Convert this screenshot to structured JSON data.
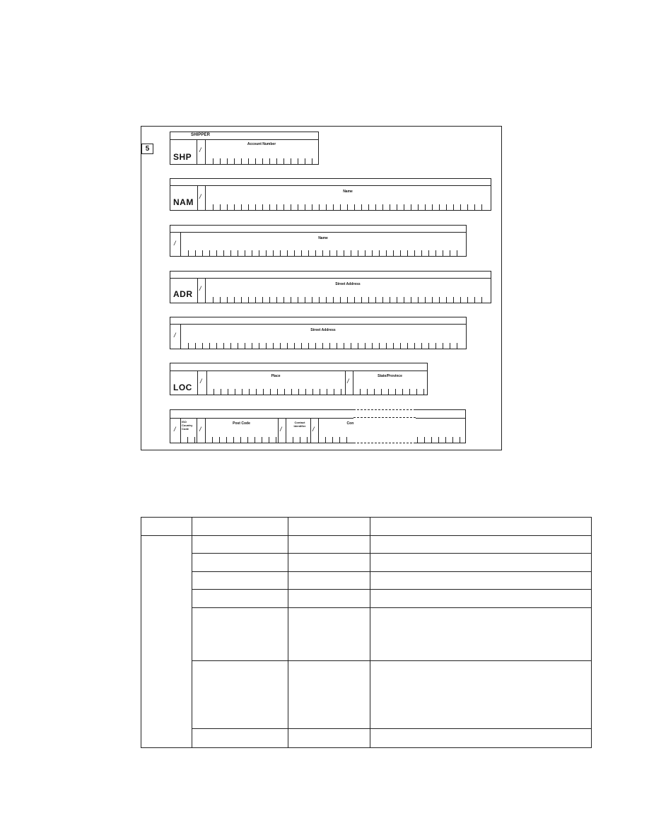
{
  "figure": {
    "step_number": "5",
    "shipper_box": {
      "title": "SHIPPER",
      "code": "SHP",
      "slash": "/",
      "field_label": "Account Number"
    },
    "name_box_1": {
      "code": "NAM",
      "slash": "/",
      "field_label": "Name"
    },
    "name_box_2": {
      "slash": "/",
      "field_label": "Name"
    },
    "address_box_1": {
      "code": "ADR",
      "slash": "/",
      "field_label": "Street Address"
    },
    "address_box_2": {
      "slash": "/",
      "field_label": "Street Address"
    },
    "location_box": {
      "code": "LOC",
      "slash": "/",
      "place_label": "Place",
      "state_label": "State/Province"
    },
    "contact_box": {
      "slash": "/",
      "iso_label": "ISO Country Code",
      "post_label": "Post Code",
      "contact_id_label": "Contact Identifier",
      "contact_number_label": "Contact Number"
    }
  },
  "table": {
    "header": [
      "",
      "",
      "",
      ""
    ],
    "rows": [
      [
        "",
        "",
        "",
        ""
      ],
      [
        "",
        "",
        "",
        ""
      ],
      [
        "",
        "",
        "",
        ""
      ],
      [
        "",
        "",
        "",
        ""
      ],
      [
        "",
        "",
        "",
        ""
      ],
      [
        "",
        "",
        "",
        ""
      ],
      [
        "",
        "",
        "",
        ""
      ]
    ]
  }
}
